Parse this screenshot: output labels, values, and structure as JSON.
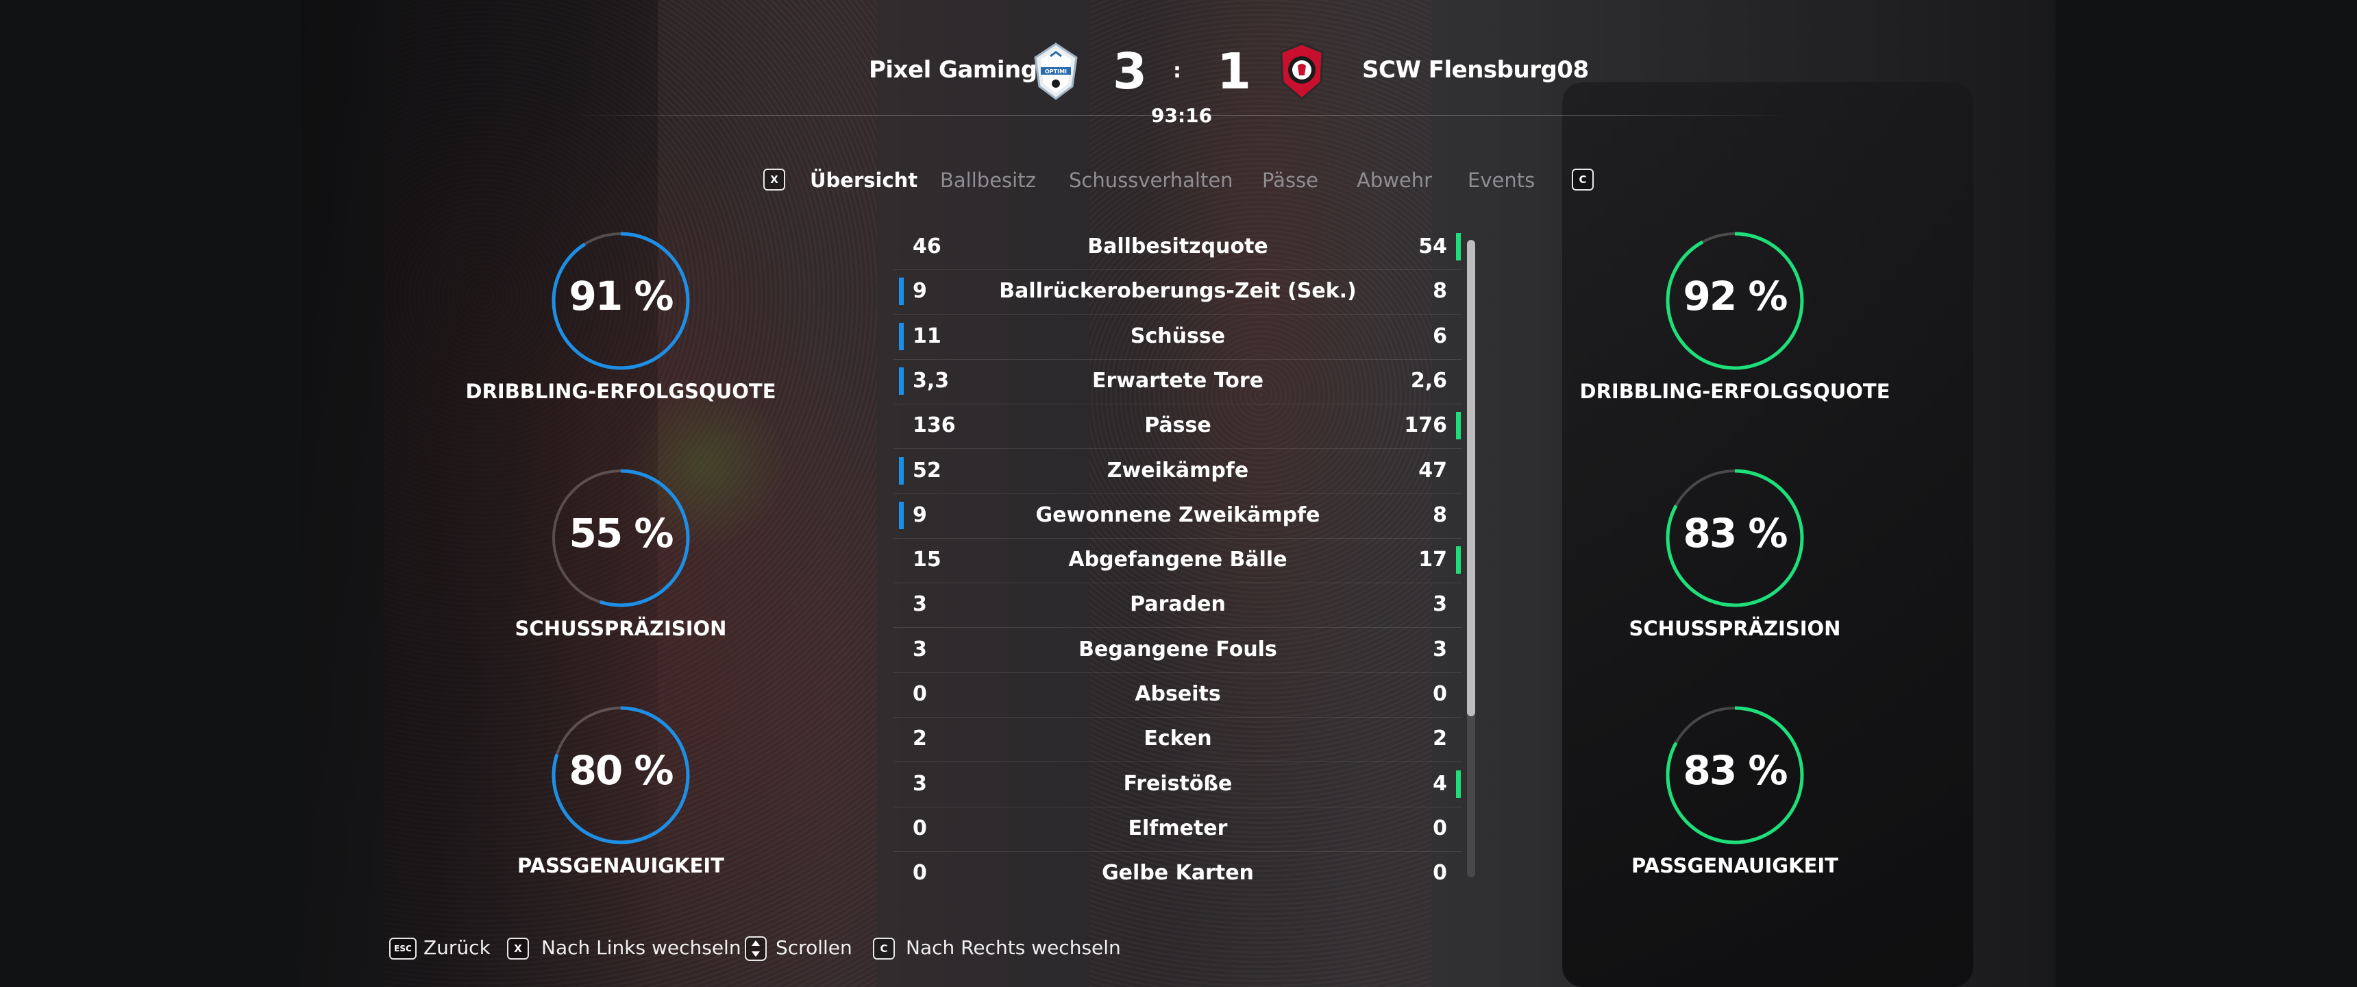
{
  "match": {
    "home_team": "Pixel Gaming",
    "away_team": "SCW Flensburg08",
    "home_score": "3",
    "away_score": "1",
    "separator": ":",
    "clock": "93:16",
    "home_crest_text": "OPTIMI",
    "home_color": "#1e8fe6",
    "away_color": "#1ee07a"
  },
  "tabs": {
    "left_key": "X",
    "right_key": "C",
    "items": [
      "Übersicht",
      "Ballbesitz",
      "Schussverhalten",
      "Pässe",
      "Abwehr",
      "Events"
    ],
    "active": "Übersicht"
  },
  "home_gauges": [
    {
      "value": "91 %",
      "percent": 91,
      "label": "DRIBBLING-ERFOLGSQUOTE"
    },
    {
      "value": "55 %",
      "percent": 55,
      "label": "SCHUSSPRÄZISION"
    },
    {
      "value": "80 %",
      "percent": 80,
      "label": "PASSGENAUIGKEIT"
    }
  ],
  "away_gauges": [
    {
      "value": "92 %",
      "percent": 92,
      "label": "DRIBBLING-ERFOLGSQUOTE"
    },
    {
      "value": "83 %",
      "percent": 83,
      "label": "SCHUSSPRÄZISION"
    },
    {
      "value": "83 %",
      "percent": 83,
      "label": "PASSGENAUIGKEIT"
    }
  ],
  "stats": [
    {
      "name": "Ballbesitzquote",
      "home": "46",
      "away": "54",
      "leader": "away"
    },
    {
      "name": "Ballrückeroberungs-Zeit (Sek.)",
      "home": "9",
      "away": "8",
      "leader": "home"
    },
    {
      "name": "Schüsse",
      "home": "11",
      "away": "6",
      "leader": "home"
    },
    {
      "name": "Erwartete Tore",
      "home": "3,3",
      "away": "2,6",
      "leader": "home"
    },
    {
      "name": "Pässe",
      "home": "136",
      "away": "176",
      "leader": "away"
    },
    {
      "name": "Zweikämpfe",
      "home": "52",
      "away": "47",
      "leader": "home"
    },
    {
      "name": "Gewonnene Zweikämpfe",
      "home": "9",
      "away": "8",
      "leader": "home"
    },
    {
      "name": "Abgefangene Bälle",
      "home": "15",
      "away": "17",
      "leader": "away"
    },
    {
      "name": "Paraden",
      "home": "3",
      "away": "3",
      "leader": "none"
    },
    {
      "name": "Begangene Fouls",
      "home": "3",
      "away": "3",
      "leader": "none"
    },
    {
      "name": "Abseits",
      "home": "0",
      "away": "0",
      "leader": "none"
    },
    {
      "name": "Ecken",
      "home": "2",
      "away": "2",
      "leader": "none"
    },
    {
      "name": "Freistöße",
      "home": "3",
      "away": "4",
      "leader": "away"
    },
    {
      "name": "Elfmeter",
      "home": "0",
      "away": "0",
      "leader": "none"
    },
    {
      "name": "Gelbe Karten",
      "home": "0",
      "away": "0",
      "leader": "none"
    }
  ],
  "footer": {
    "back_key": "ESC",
    "back_label": "Zurück",
    "left_key": "X",
    "left_label": "Nach Links wechseln",
    "scroll_label": "Scrollen",
    "right_key": "C",
    "right_label": "Nach Rechts wechseln"
  }
}
